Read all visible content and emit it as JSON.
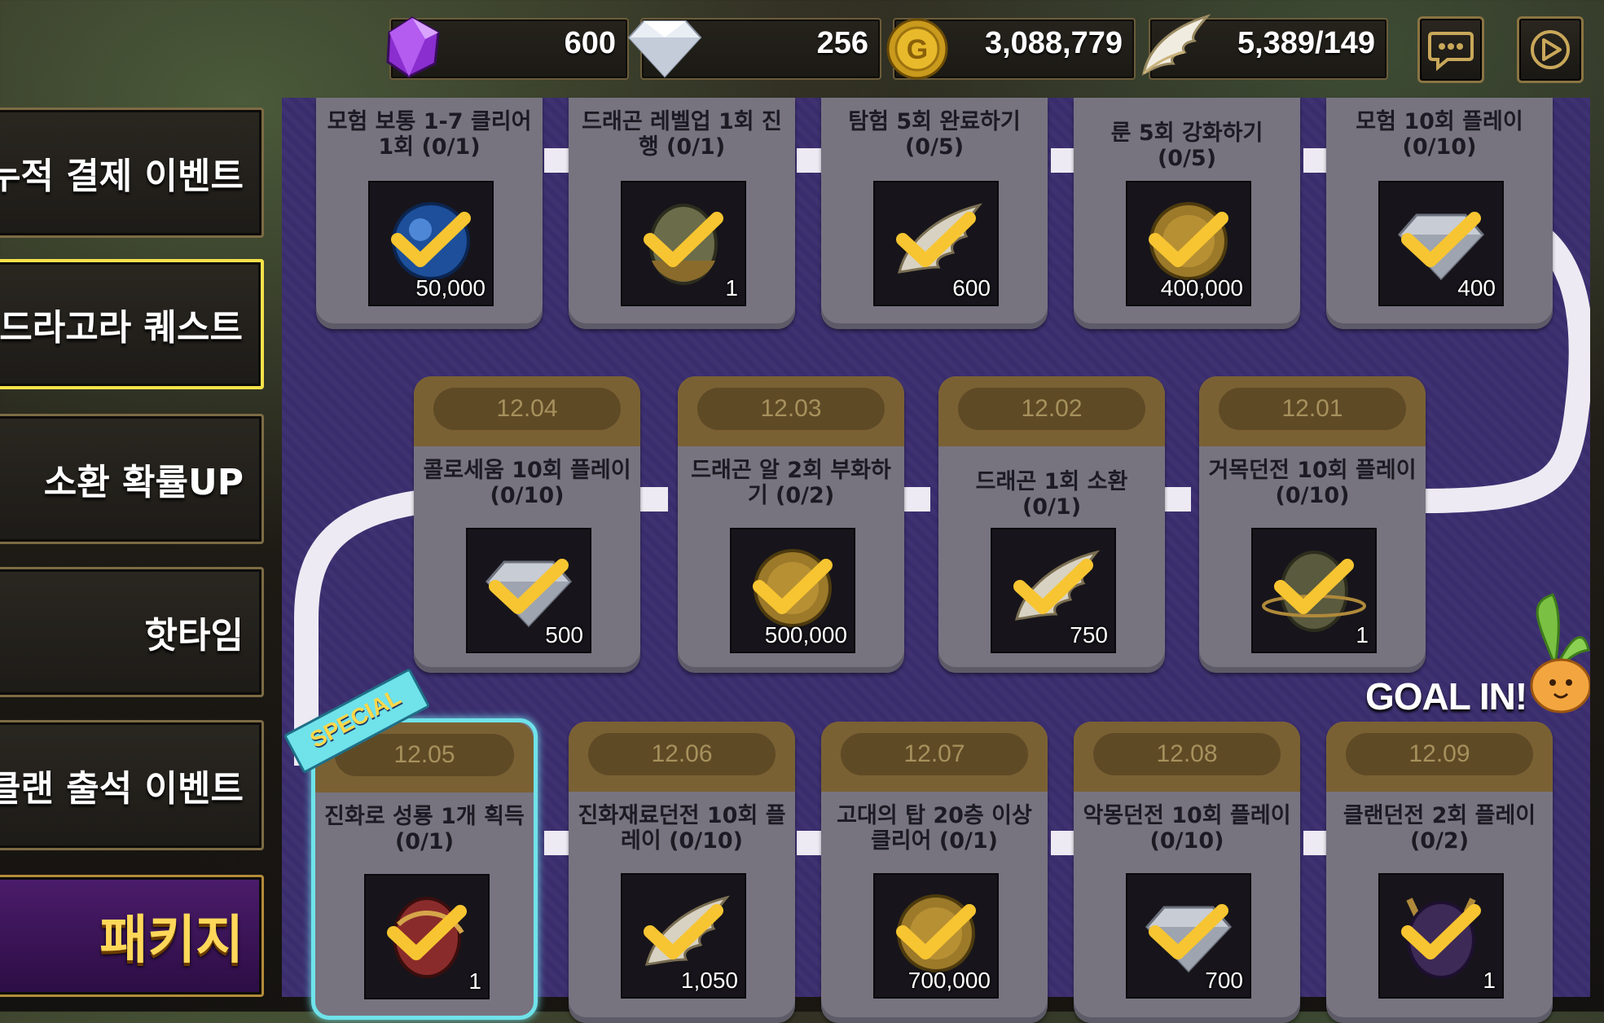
{
  "currencies": {
    "gem": "600",
    "diamond": "256",
    "gold": "3,088,779",
    "wing": "5,389/149"
  },
  "top_icons": [
    "chat-icon",
    "settings-icon"
  ],
  "sidebar": {
    "items": [
      {
        "label": "누적 결제 이벤트",
        "active": false
      },
      {
        "label": "만드라고라 퀘스트",
        "active": true
      },
      {
        "label": "소환 확률UP",
        "active": false
      },
      {
        "label": "핫타임",
        "active": false
      },
      {
        "label": "클랜 출석 이벤트",
        "active": false
      },
      {
        "label": "패키지",
        "active": false
      }
    ]
  },
  "quests": {
    "row1": [
      {
        "title_l1": "모험 보통 1-7 클리어",
        "title_l2": "1회 (0/1)",
        "reward_icon": "orb-icon",
        "amount": "50,000"
      },
      {
        "title_l1": "드래곤 레벨업 1회 진",
        "title_l2": "행 (0/1)",
        "reward_icon": "dragon-egg-icon",
        "amount": "1"
      },
      {
        "title_l1": "탐험 5회 완료하기",
        "title_l2": "(0/5)",
        "reward_icon": "wing-icon",
        "amount": "600"
      },
      {
        "title_l1": "룬 5회 강화하기 (0/5)",
        "title_l2": "",
        "reward_icon": "gold-coin-icon",
        "amount": "400,000"
      },
      {
        "title_l1": "모험 10회 플레이",
        "title_l2": "(0/10)",
        "reward_icon": "diamond-icon",
        "amount": "400"
      }
    ],
    "row2": [
      {
        "date": "12.04",
        "title_l1": "콜로세움 10회 플레이",
        "title_l2": "(0/10)",
        "reward_icon": "diamond-icon",
        "amount": "500"
      },
      {
        "date": "12.03",
        "title_l1": "드래곤 알 2회 부화하",
        "title_l2": "기 (0/2)",
        "reward_icon": "gold-coin-icon",
        "amount": "500,000"
      },
      {
        "date": "12.02",
        "title_l1": "드래곤 1회 소환 (0/1)",
        "title_l2": "",
        "reward_icon": "wing-icon",
        "amount": "750"
      },
      {
        "date": "12.01",
        "title_l1": "거목던전 10회 플레이",
        "title_l2": "(0/10)",
        "reward_icon": "dragon-egg-icon",
        "amount": "1"
      }
    ],
    "row3": [
      {
        "date": "12.05",
        "title_l1": "진화로 성룡 1개 획득",
        "title_l2": "(0/1)",
        "reward_icon": "dragon-egg-icon",
        "amount": "1",
        "special": true
      },
      {
        "date": "12.06",
        "title_l1": "진화재료던전 10회 플",
        "title_l2": "레이 (0/10)",
        "reward_icon": "wing-icon",
        "amount": "1,050"
      },
      {
        "date": "12.07",
        "title_l1": "고대의 탑 20층 이상",
        "title_l2": "클리어 (0/1)",
        "reward_icon": "gold-coin-icon",
        "amount": "700,000"
      },
      {
        "date": "12.08",
        "title_l1": "악몽던전 10회 플레이",
        "title_l2": "(0/10)",
        "reward_icon": "diamond-icon",
        "amount": "700"
      },
      {
        "date": "12.09",
        "title_l1": "클랜던전 2회 플레이",
        "title_l2": "(0/2)",
        "reward_icon": "dragon-egg-icon",
        "amount": "1"
      }
    ]
  },
  "special_badge": "SPECIAL",
  "goal_text": "GOAL IN!",
  "colors": {
    "board": "#3a2d6e",
    "card": "#777480",
    "date_band": "#7a6134",
    "check": "#f7c531",
    "active_border": "#f7e24a",
    "special_border": "#6fe2ea"
  }
}
